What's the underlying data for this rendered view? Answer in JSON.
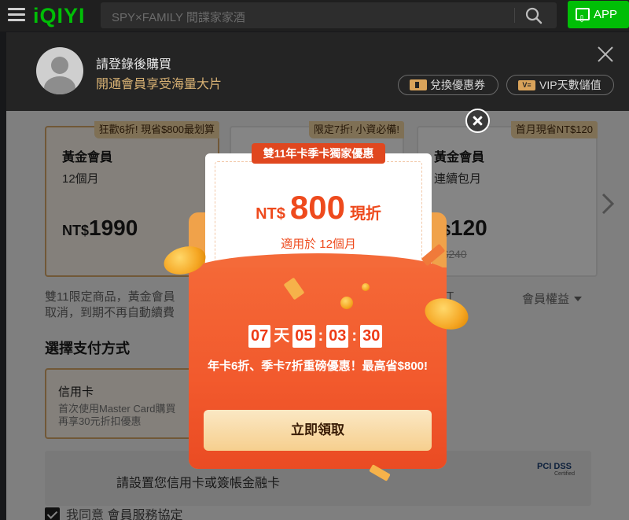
{
  "topbar": {
    "logo": "iQIYI",
    "search_placeholder": "SPY×FAMILY 間諜家家酒",
    "app_label": "APP"
  },
  "header": {
    "login_title": "請登錄後購買",
    "login_subtitle": "開通會員享受海量大片",
    "coupon_button": "兌換優惠券",
    "vip_button": "VIP天數儲值"
  },
  "plans": [
    {
      "badge": "狂歡6折! 現省$800最划算",
      "name": "黃金會員",
      "term": "12個月",
      "currency": "NT$",
      "price": "1990",
      "old_price": ""
    },
    {
      "badge": "限定7折! 小資必備!",
      "name": "",
      "term": "",
      "currency": "",
      "price": "",
      "old_price": ""
    },
    {
      "badge": "首月現省NT$120",
      "name": "黃金會員",
      "term": "連續包月",
      "currency": "T$",
      "price": "120",
      "old_price": "T$240"
    }
  ],
  "notes": {
    "line1": "雙11限定商品，黃金會員",
    "line2": "取消，到期不再自動續費",
    "fragment": "T",
    "benefits": "會員權益"
  },
  "payment": {
    "heading": "選擇支付方式",
    "card_name": "信用卡",
    "card_desc1": "首次使用Master Card購買",
    "card_desc2": "再享30元折扣優惠",
    "setup_text": "請設置您信用卡或簽帳金融卡",
    "pci_label": "PCI DSS",
    "pci_sub": "Certified"
  },
  "agreement": {
    "prefix": "我同意",
    "link": "會員服務協定",
    "checked": true
  },
  "promo": {
    "ribbon": "雙11年卡季卡獨家優惠",
    "currency": "NT$",
    "amount": "800",
    "tag": "現折",
    "applies": "適用於 12個月",
    "timer": {
      "days": "07",
      "day_label": "天",
      "hours": "05",
      "minutes": "03",
      "seconds": "30"
    },
    "message": "年卡6折、季卡7折重磅優惠！最高省$800!",
    "claim_button": "立即領取"
  },
  "colors": {
    "brand_green": "#00be06",
    "gold": "#d8a96a",
    "promo_red": "#ee4a1d",
    "envelope": "#f25a2d"
  }
}
